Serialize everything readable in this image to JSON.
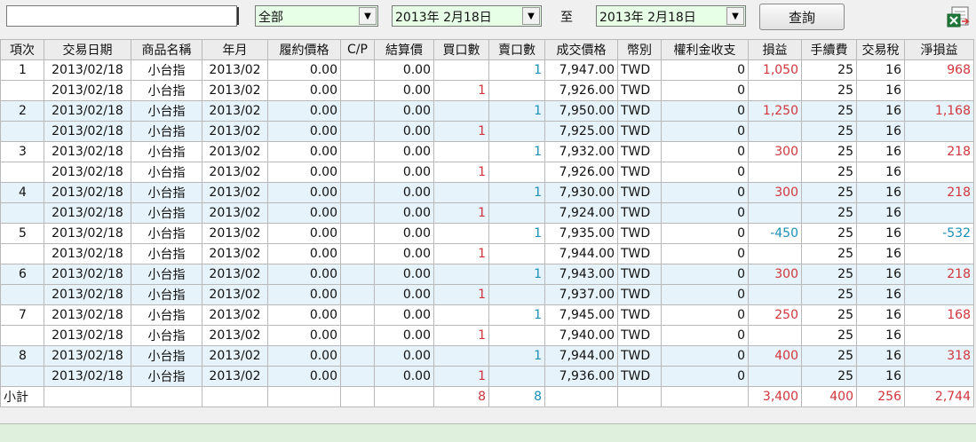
{
  "toolbar": {
    "search_value": "",
    "category_value": "全部",
    "date_from": "2013年  2月18日",
    "to_label": "至",
    "date_to": "2013年  2月18日",
    "query_label": "查詢",
    "export_icon": "excel-export-icon"
  },
  "table": {
    "columns": [
      "項次",
      "交易日期",
      "商品名稱",
      "年月",
      "履約價格",
      "C/P",
      "結算價",
      "買口數",
      "賣口數",
      "成交價格",
      "幣別",
      "權利金收支",
      "損益",
      "手續費",
      "交易稅",
      "淨損益"
    ],
    "rows": [
      [
        "1",
        "2013/02/18",
        "小台指",
        "2013/02",
        "0.00",
        "",
        "0.00",
        "",
        "1",
        "7,947.00",
        "TWD",
        "0",
        "1,050",
        "25",
        "16",
        "968"
      ],
      [
        "",
        "2013/02/18",
        "小台指",
        "2013/02",
        "0.00",
        "",
        "0.00",
        "1",
        "",
        "7,926.00",
        "TWD",
        "0",
        "",
        "25",
        "16",
        ""
      ],
      [
        "2",
        "2013/02/18",
        "小台指",
        "2013/02",
        "0.00",
        "",
        "0.00",
        "",
        "1",
        "7,950.00",
        "TWD",
        "0",
        "1,250",
        "25",
        "16",
        "1,168"
      ],
      [
        "",
        "2013/02/18",
        "小台指",
        "2013/02",
        "0.00",
        "",
        "0.00",
        "1",
        "",
        "7,925.00",
        "TWD",
        "0",
        "",
        "25",
        "16",
        ""
      ],
      [
        "3",
        "2013/02/18",
        "小台指",
        "2013/02",
        "0.00",
        "",
        "0.00",
        "",
        "1",
        "7,932.00",
        "TWD",
        "0",
        "300",
        "25",
        "16",
        "218"
      ],
      [
        "",
        "2013/02/18",
        "小台指",
        "2013/02",
        "0.00",
        "",
        "0.00",
        "1",
        "",
        "7,926.00",
        "TWD",
        "0",
        "",
        "25",
        "16",
        ""
      ],
      [
        "4",
        "2013/02/18",
        "小台指",
        "2013/02",
        "0.00",
        "",
        "0.00",
        "",
        "1",
        "7,930.00",
        "TWD",
        "0",
        "300",
        "25",
        "16",
        "218"
      ],
      [
        "",
        "2013/02/18",
        "小台指",
        "2013/02",
        "0.00",
        "",
        "0.00",
        "1",
        "",
        "7,924.00",
        "TWD",
        "0",
        "",
        "25",
        "16",
        ""
      ],
      [
        "5",
        "2013/02/18",
        "小台指",
        "2013/02",
        "0.00",
        "",
        "0.00",
        "",
        "1",
        "7,935.00",
        "TWD",
        "0",
        "-450",
        "25",
        "16",
        "-532"
      ],
      [
        "",
        "2013/02/18",
        "小台指",
        "2013/02",
        "0.00",
        "",
        "0.00",
        "1",
        "",
        "7,944.00",
        "TWD",
        "0",
        "",
        "25",
        "16",
        ""
      ],
      [
        "6",
        "2013/02/18",
        "小台指",
        "2013/02",
        "0.00",
        "",
        "0.00",
        "",
        "1",
        "7,943.00",
        "TWD",
        "0",
        "300",
        "25",
        "16",
        "218"
      ],
      [
        "",
        "2013/02/18",
        "小台指",
        "2013/02",
        "0.00",
        "",
        "0.00",
        "1",
        "",
        "7,937.00",
        "TWD",
        "0",
        "",
        "25",
        "16",
        ""
      ],
      [
        "7",
        "2013/02/18",
        "小台指",
        "2013/02",
        "0.00",
        "",
        "0.00",
        "",
        "1",
        "7,945.00",
        "TWD",
        "0",
        "250",
        "25",
        "16",
        "168"
      ],
      [
        "",
        "2013/02/18",
        "小台指",
        "2013/02",
        "0.00",
        "",
        "0.00",
        "1",
        "",
        "7,940.00",
        "TWD",
        "0",
        "",
        "25",
        "16",
        ""
      ],
      [
        "8",
        "2013/02/18",
        "小台指",
        "2013/02",
        "0.00",
        "",
        "0.00",
        "",
        "1",
        "7,944.00",
        "TWD",
        "0",
        "400",
        "25",
        "16",
        "318"
      ],
      [
        "",
        "2013/02/18",
        "小台指",
        "2013/02",
        "0.00",
        "",
        "0.00",
        "1",
        "",
        "7,936.00",
        "TWD",
        "0",
        "",
        "25",
        "16",
        ""
      ]
    ],
    "subtotal": [
      "小計",
      "",
      "",
      "",
      "",
      "",
      "",
      "8",
      "8",
      "",
      "",
      "",
      "3,400",
      "400",
      "256",
      "2,744"
    ]
  },
  "colors": {
    "positive": "#d0363b",
    "negative": "#1a8fb8",
    "row_alt": "#e6f3fa",
    "combo_bg": "#e6ffe6",
    "footer_bg": "#dff0dc"
  }
}
